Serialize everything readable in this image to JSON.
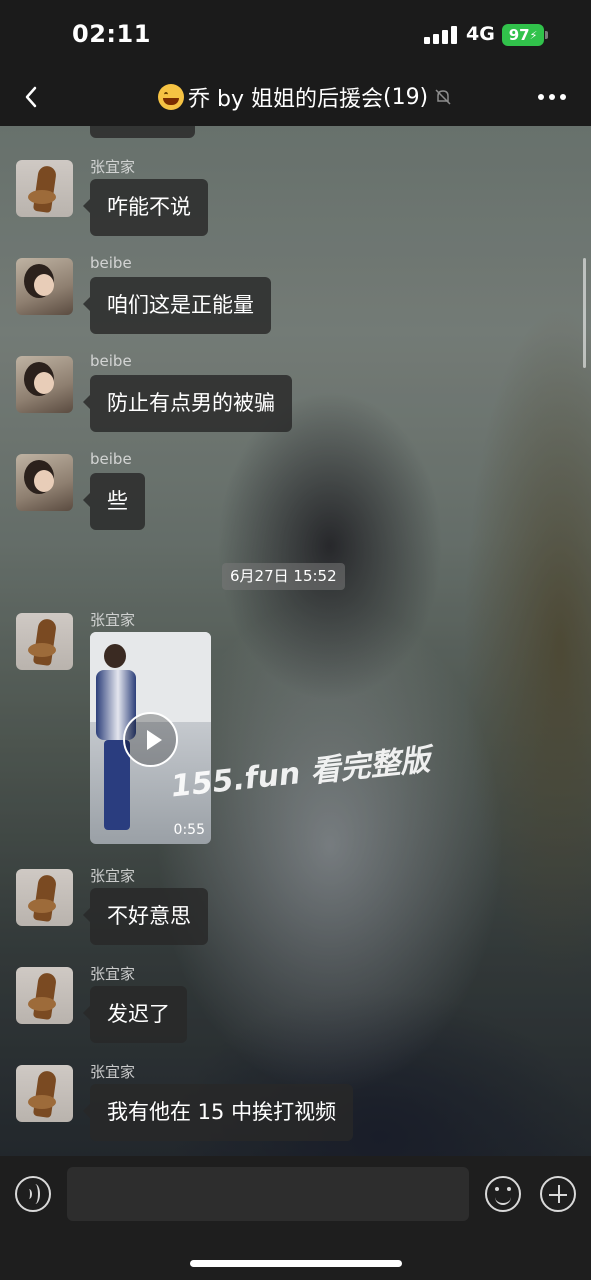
{
  "status_bar": {
    "time": "02:11",
    "network": "4G",
    "battery": "97"
  },
  "header": {
    "title": "乔 by 姐姐的后援会",
    "member_count": "(19)",
    "emoji": "grinning-sweat-emoji",
    "muted": true
  },
  "messages": [
    {
      "sender": "张宜家",
      "text": "咋能不说",
      "avatar": "zhang"
    },
    {
      "sender": "beibe",
      "text": "咱们这是正能量",
      "avatar": "beibe"
    },
    {
      "sender": "beibe",
      "text": "防止有点男的被骗",
      "avatar": "beibe"
    },
    {
      "sender": "beibe",
      "text": "些",
      "avatar": "beibe"
    },
    {
      "timestamp": "6月27日 15:52"
    },
    {
      "sender": "张宜家",
      "type": "video",
      "duration": "0:55",
      "avatar": "zhang"
    },
    {
      "sender": "张宜家",
      "text": "不好意思",
      "avatar": "zhang"
    },
    {
      "sender": "张宜家",
      "text": "发迟了",
      "avatar": "zhang"
    },
    {
      "sender": "张宜家",
      "text": "我有他在 15 中挨打视频",
      "avatar": "zhang"
    }
  ],
  "watermark": "155.fun 看完整版",
  "input_bar": {
    "placeholder": "",
    "icons": [
      "voice-icon",
      "emoji-icon",
      "plus-icon"
    ]
  },
  "colors": {
    "battery": "#31c24b",
    "bubble": "#282828",
    "bar": "#1b1b1b"
  }
}
